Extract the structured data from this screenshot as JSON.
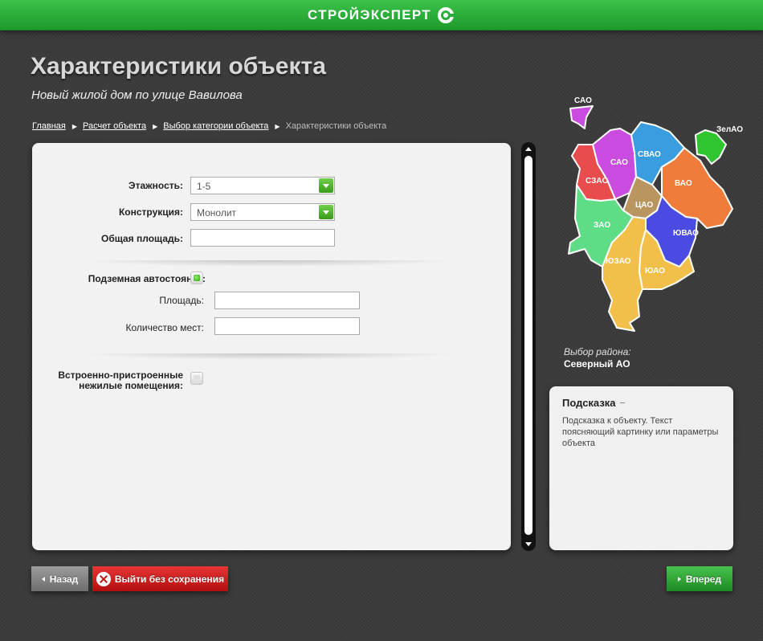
{
  "header": {
    "logo_text": "СТРОЙЭКСПЕРТ"
  },
  "page": {
    "title": "Характеристики объекта",
    "subtitle": "Новый жилой дом по улице Вавилова"
  },
  "breadcrumb": [
    {
      "label": "Главная"
    },
    {
      "label": "Расчет объекта"
    },
    {
      "label": "Выбор категории объекта"
    },
    {
      "label": "Характеристики объекта"
    }
  ],
  "form": {
    "floors_label": "Этажность:",
    "floors_value": "1-5",
    "construction_label": "Конструкция:",
    "construction_value": "Монолит",
    "total_area_label": "Общая площадь:",
    "total_area_value": "",
    "parking_label": "Подземная автостоянка:",
    "parking_checked": true,
    "parking_area_label": "Площадь:",
    "parking_area_value": "",
    "parking_places_label": "Количество мест:",
    "parking_places_value": "",
    "nonresidential_label_line1": "Встроенно-пристроенные",
    "nonresidential_label_line2": "нежилые помещения:",
    "nonresidential_checked": false
  },
  "map": {
    "districts": [
      "САО",
      "СВАО",
      "СЗАО",
      "ВАО",
      "ЦАО",
      "ЗАО",
      "ЮВАО",
      "ЮЗАО",
      "ЮАО",
      "ЗелАО"
    ],
    "caption_label": "Выбор района:",
    "selected_district": "Северный АО",
    "colors": {
      "SAO": "#c94bdf",
      "SVAO": "#3a9de0",
      "SZAO": "#e84c4c",
      "VAO": "#f07c3c",
      "CAO": "#b9965f",
      "ZAO": "#5fdc86",
      "UVAO": "#4a4be0",
      "UZAO": "#f2c04a",
      "UAO": "#f2c04a",
      "ZelAO": "#2ec52e"
    }
  },
  "hint": {
    "title": "Подсказка",
    "text": "Подсказка к объекту. Текст поясняющий картинку или параметры объекта"
  },
  "buttons": {
    "back": "Назад",
    "exit": "Выйти без сохранения",
    "next": "Вперед"
  }
}
